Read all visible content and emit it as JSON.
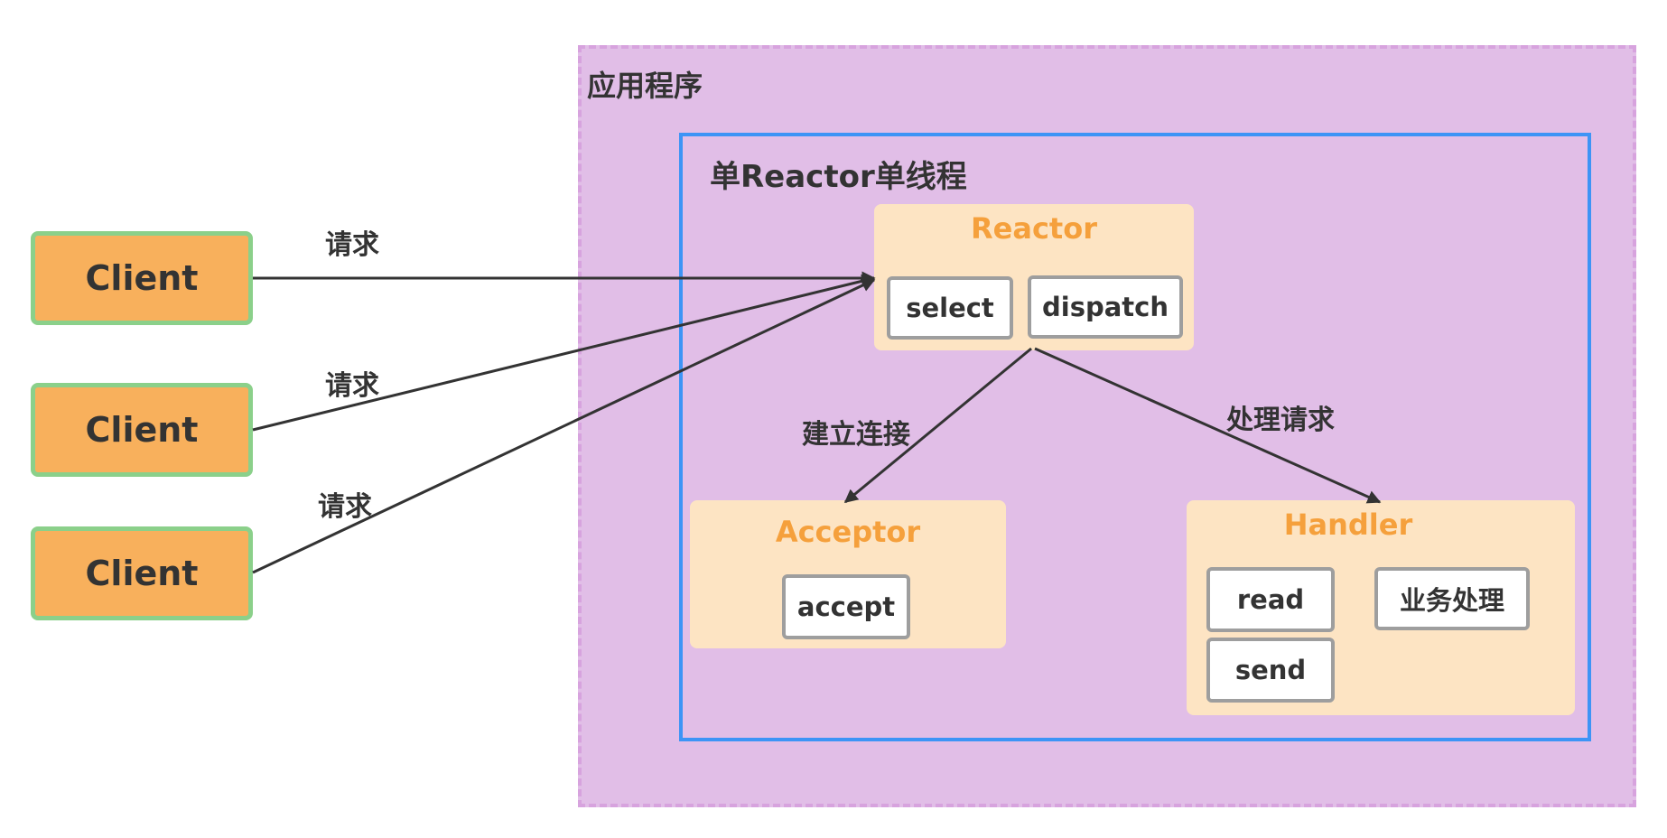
{
  "diagram": {
    "app_region": {
      "label": "应用程序"
    },
    "reactor_region": {
      "label": "单Reactor单线程"
    },
    "reactor": {
      "title": "Reactor",
      "methods": {
        "select": "select",
        "dispatch": "dispatch"
      }
    },
    "acceptor": {
      "title": "Acceptor",
      "methods": {
        "accept": "accept"
      }
    },
    "handler": {
      "title": "Handler",
      "methods": {
        "read": "read",
        "send": "send",
        "business": "业务处理"
      }
    },
    "clients": [
      {
        "label": "Client",
        "request_label": "请求"
      },
      {
        "label": "Client",
        "request_label": "请求"
      },
      {
        "label": "Client",
        "request_label": "请求"
      }
    ],
    "edges": {
      "to_acceptor": "建立连接",
      "to_handler": "处理请求"
    },
    "colors": {
      "app_region_fill": "#e1bee7",
      "app_region_border": "#d7a3de",
      "reactor_region_border": "#3d94f6",
      "panel_fill": "#fde4c3",
      "panel_title": "#f5a03c",
      "client_fill": "#f8b05c",
      "client_border": "#8bd08a",
      "method_border": "#9e9e9e",
      "arrow": "#333333"
    }
  }
}
